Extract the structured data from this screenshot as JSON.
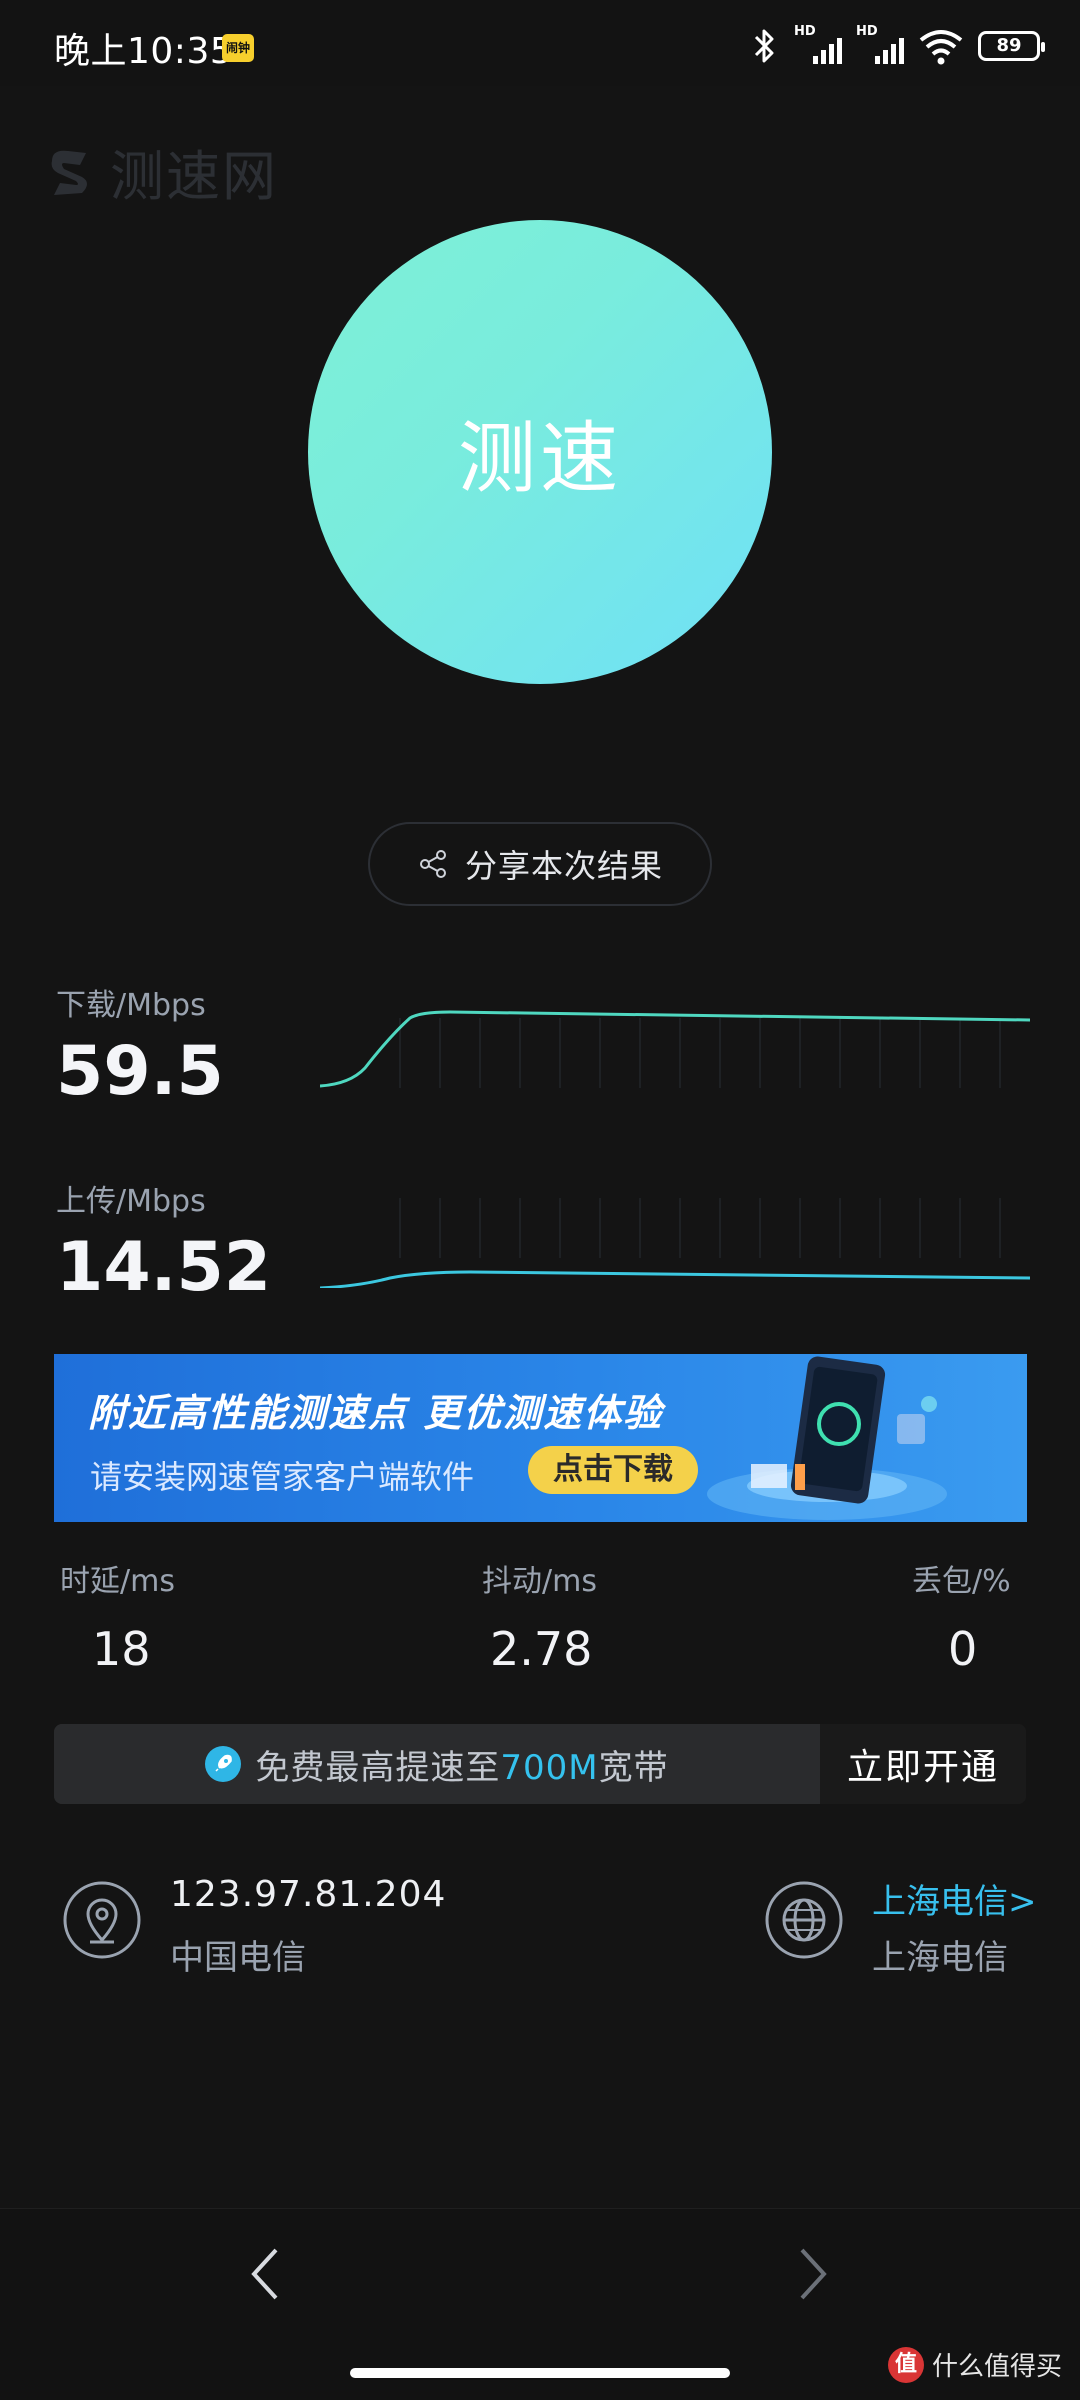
{
  "status_bar": {
    "time": "晚上10:35",
    "badge_text": "闹钟",
    "network_labels": [
      "HD",
      "HD"
    ],
    "battery": "89",
    "icons": [
      "bluetooth-icon",
      "signal-icon",
      "wifi-icon",
      "battery-icon"
    ]
  },
  "app": {
    "logo_text": "测速网"
  },
  "test": {
    "button_label": "测速",
    "gradient_colors": [
      "#7ef0d6",
      "#6fe0f7"
    ]
  },
  "share": {
    "label": "分享本次结果",
    "icon": "share-icon"
  },
  "download": {
    "label": "下载/Mbps",
    "value": "59.5",
    "color": "#4fd8c0"
  },
  "upload": {
    "label": "上传/Mbps",
    "value": "14.52",
    "color": "#3cc8e0"
  },
  "ad": {
    "headline": "附近高性能测速点  更优测速体验",
    "subtext": "请安装网速管家客户端软件",
    "button": "点击下载"
  },
  "stats": {
    "latency_label": "时延/ms",
    "latency_value": "18",
    "jitter_label": "抖动/ms",
    "jitter_value": "2.78",
    "loss_label": "丢包/%",
    "loss_value": "0"
  },
  "promo": {
    "text_prefix": "免费最高提速至",
    "text_highlight": "700M",
    "text_suffix": "宽带",
    "button": "立即开通",
    "highlight_color": "#35c2ee"
  },
  "network": {
    "ip": "123.97.81.204",
    "isp": "中国电信",
    "server_link": "上海电信>",
    "server_name": "上海电信"
  },
  "watermark": {
    "icon_text": "值",
    "text": "什么值得买"
  },
  "nav": {
    "back_icon": "chevron-left-icon",
    "forward_icon": "chevron-right-icon"
  }
}
